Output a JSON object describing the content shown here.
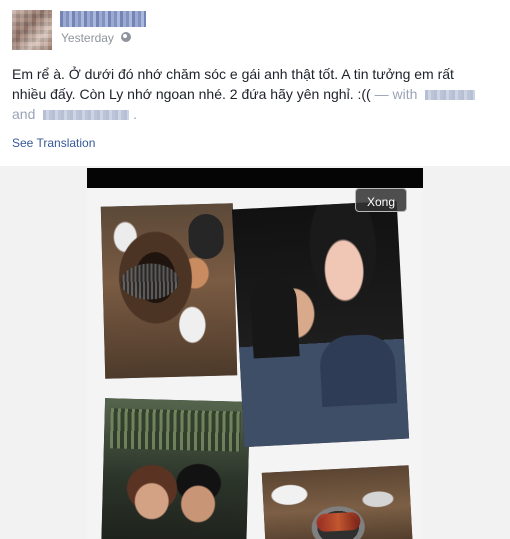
{
  "post": {
    "timestamp": "Yesterday",
    "text_main": "Em rể à. Ở dưới đó nhớ chăm sóc e gái anh thật tốt. A tin tưởng em rất nhiều đấy. Còn Ly nhớ ngoan nhé. 2 đứa hãy yên nghỉ. :((",
    "text_with": " — with",
    "text_and": "and",
    "text_period": ".",
    "see_translation": "See Translation"
  },
  "viewer": {
    "done_label": "Xong"
  },
  "icons": {
    "privacy": "globe-icon"
  }
}
